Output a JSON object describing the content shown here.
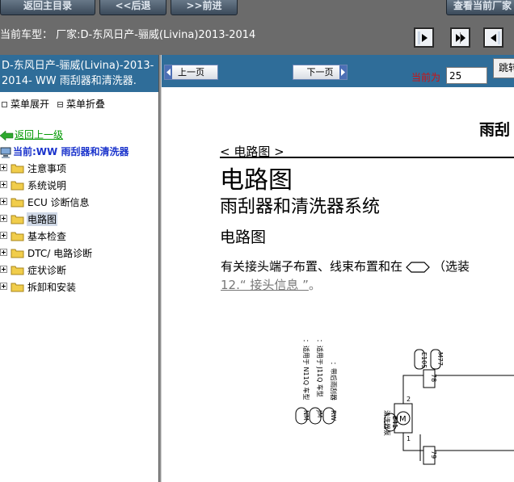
{
  "toolbar": {
    "home_label": "返回主目录",
    "back_label": "<<后退",
    "forward_label": ">>前进",
    "current_label": "查看当前厂家"
  },
  "model_bar": {
    "text": "当前车型：  厂家:D-东风日产-骊威(Livina)2013-2014"
  },
  "sidebar": {
    "title": "D-东风日产-骊威(Livina)-2013-2014- WW 雨刮器和清洗器.",
    "expand_label": "菜单展开",
    "collapse_label": "菜单折叠",
    "back_link": "返回上一级",
    "current": "当前:WW 雨刮器和清洗器",
    "items": [
      {
        "label": "注意事项"
      },
      {
        "label": "系统说明"
      },
      {
        "label": "ECU 诊断信息"
      },
      {
        "label": "电路图"
      },
      {
        "label": "基本检查"
      },
      {
        "label": "DTC/ 电路诊断"
      },
      {
        "label": "症状诊断"
      },
      {
        "label": "拆卸和安装"
      }
    ]
  },
  "pager": {
    "prev_label": "上一页",
    "next_label": "下一页",
    "current_label": "当前为",
    "page_value": "25",
    "jump_label": "跳转"
  },
  "doc": {
    "header": "雨刮",
    "breadcrumb": "< 电路图 >",
    "title": "电路图",
    "subtitle": "雨刮器和清洗器系统",
    "section": "电路图",
    "para_prefix": "有关接头端子布置、线束布置和在",
    "para_suffix": "（选装",
    "para_link": "12.“ 接头信息 ”",
    "para_end": "。",
    "schematic": {
      "legend": [
        {
          "code": "NM",
          "text": "：适用于 N11Q 车型"
        },
        {
          "code": "JM",
          "text": "：适用于 J11Q 车型"
        },
        {
          "code": "RW",
          "text": "：带后雨刮器"
        }
      ],
      "motor_label": "清洗器泵",
      "motor_code": "E41",
      "motor_symbol": "M",
      "pin_top": "2",
      "pin_bottom": "1",
      "connector_top": "78",
      "connector_bottom": "79",
      "tag_e105": "E105",
      "tag_m77": "M77"
    }
  }
}
